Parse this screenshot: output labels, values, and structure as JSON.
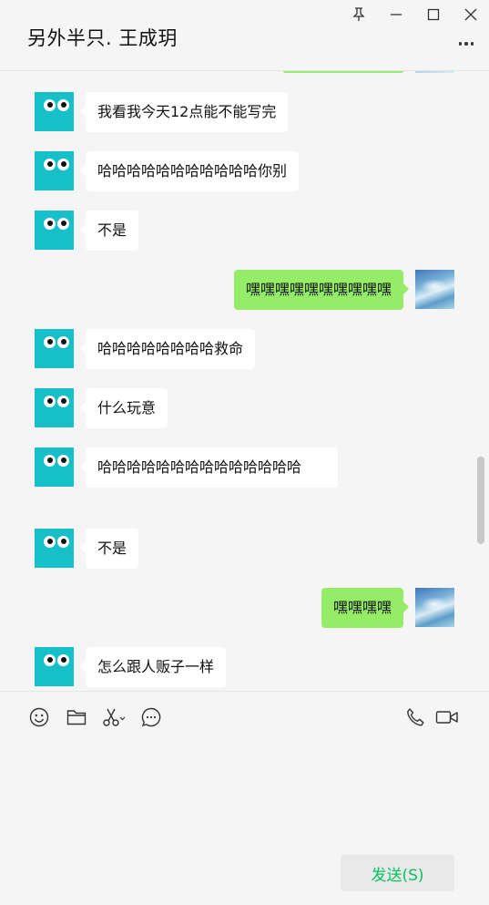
{
  "header": {
    "title": "另外半只. 王成玥"
  },
  "window_controls": [
    {
      "name": "pin-icon"
    },
    {
      "name": "minimize-icon"
    },
    {
      "name": "maximize-icon"
    },
    {
      "name": "close-icon"
    }
  ],
  "messages": [
    {
      "sender": "other",
      "text": "我看我今天12点能不能写完"
    },
    {
      "sender": "other",
      "text": "哈哈哈哈哈哈哈哈哈哈哈你别"
    },
    {
      "sender": "other",
      "text": "不是"
    },
    {
      "sender": "self",
      "text": "嘿嘿嘿嘿嘿嘿嘿嘿嘿嘿"
    },
    {
      "sender": "other",
      "text": "哈哈哈哈哈哈哈哈救命"
    },
    {
      "sender": "other",
      "text": "什么玩意"
    },
    {
      "sender": "other",
      "text": "哈哈哈哈哈哈哈哈哈哈哈哈哈哈"
    },
    {
      "sender": "other",
      "text": "不是"
    },
    {
      "sender": "self",
      "text": "嘿嘿嘿嘿"
    },
    {
      "sender": "other",
      "text": "怎么跟人贩子一样"
    }
  ],
  "toolbar": {
    "left_icons": [
      "emoji-icon",
      "folder-icon",
      "scissors-icon",
      "chat-history-icon"
    ],
    "right_icons": [
      "phone-icon",
      "video-call-icon"
    ]
  },
  "input": {
    "value": ""
  },
  "send_button": {
    "label": "发送(S)"
  },
  "colors": {
    "self_bubble": "#95ec69",
    "other_bubble": "#ffffff",
    "send_text": "#07c160",
    "avatar_bg": "#17bfc8"
  }
}
